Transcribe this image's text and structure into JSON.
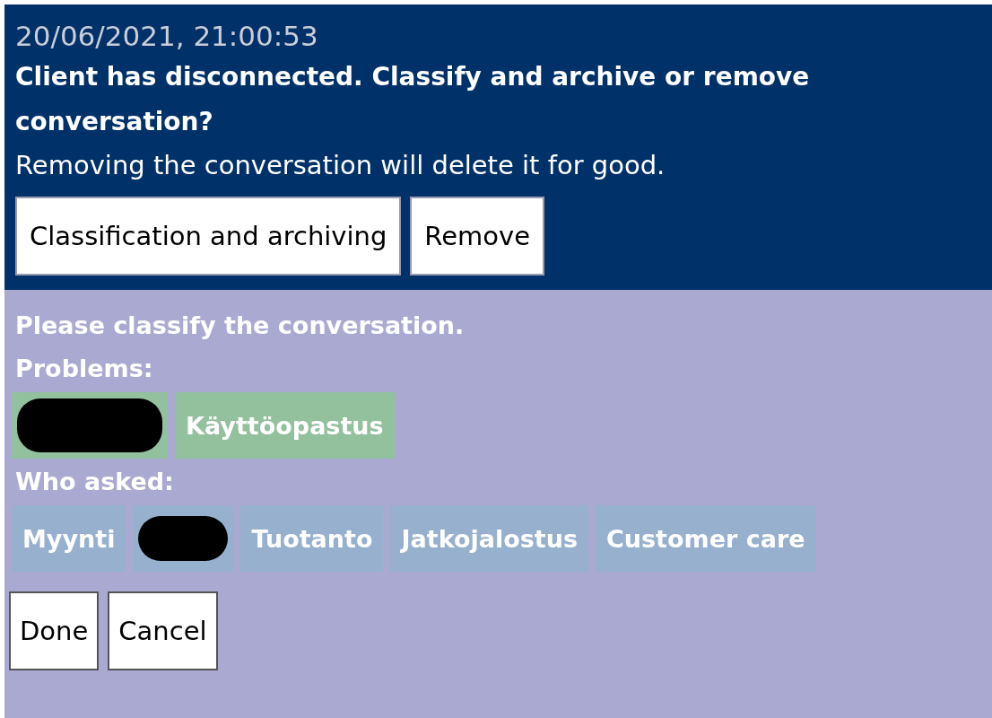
{
  "notice": {
    "timestamp": "20/06/2021, 21:00:53",
    "title": "Client has disconnected. Classify and archive or remove conversation?",
    "message": "Removing the conversation will delete it for good.",
    "buttons": [
      "Classification and archiving",
      "Remove"
    ]
  },
  "classification": {
    "prompt": "Please classify the conversation.",
    "groups": [
      {
        "label": "Problems:",
        "kind": "problem",
        "tags": [
          {
            "kind": "redacted"
          },
          {
            "kind": "tag",
            "label": "Käyttöopastus"
          }
        ]
      },
      {
        "label": "Who asked:",
        "kind": "asker",
        "tags": [
          {
            "kind": "tag",
            "label": "Myynti"
          },
          {
            "kind": "redacted"
          },
          {
            "kind": "tag",
            "label": "Tuotanto"
          },
          {
            "kind": "tag",
            "label": "Jatkojalostus"
          },
          {
            "kind": "tag",
            "label": "Customer care"
          }
        ]
      }
    ],
    "buttons": [
      "Done",
      "Cancel"
    ]
  }
}
